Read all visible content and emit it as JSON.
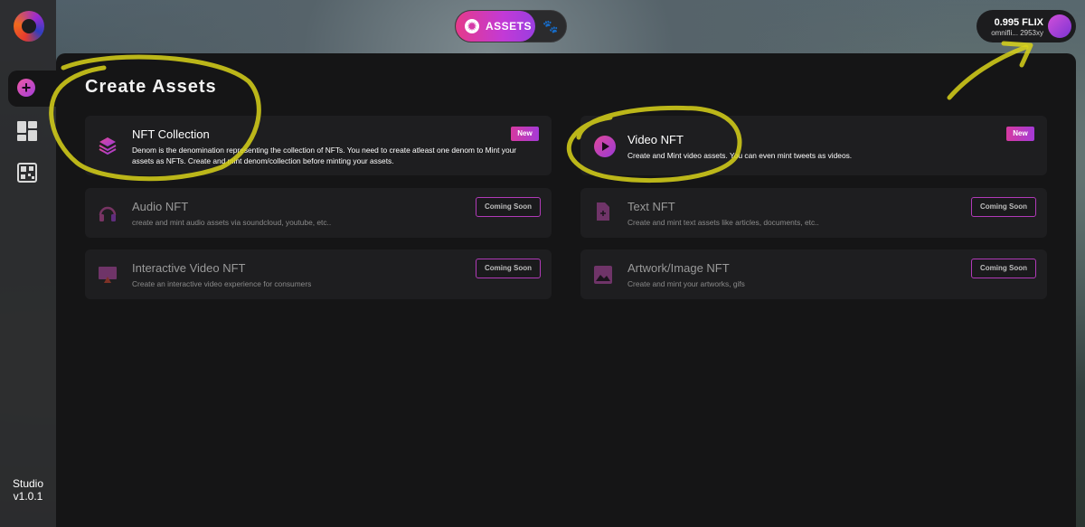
{
  "sidebar": {
    "items": [
      {
        "name": "create",
        "icon": "plus-circle-icon"
      },
      {
        "name": "dashboard",
        "icon": "dashboard-icon"
      },
      {
        "name": "qr",
        "icon": "qr-code-icon"
      }
    ],
    "footer_line1": "Studio",
    "footer_line2": "v1.0.1"
  },
  "header": {
    "tabs": [
      {
        "label": "ASSETS",
        "icon": "gear-icon",
        "active": true
      },
      {
        "label": "",
        "icon": "paw-icon",
        "active": false
      }
    ]
  },
  "wallet": {
    "balance": "0.995 FLIX",
    "address": "omnifli... 2953xy"
  },
  "main": {
    "title": "Create Assets",
    "cards": [
      {
        "title": "NFT Collection",
        "desc": "Denom is the denomination representing the collection of NFTs. You need to create atleast one denom to Mint your assets as NFTs. Create and mint denom/collection before minting your assets.",
        "badge": "New",
        "icon": "layers-icon"
      },
      {
        "title": "Video NFT",
        "desc": "Create and Mint video assets. You can even mint tweets as videos.",
        "badge": "New",
        "icon": "play-icon"
      },
      {
        "title": "Audio NFT",
        "desc": "create and mint audio assets via soundcloud, youtube, etc..",
        "badge": "Coming Soon",
        "icon": "headphones-icon"
      },
      {
        "title": "Text NFT",
        "desc": "Create and mint text assets like articles, documents, etc..",
        "badge": "Coming Soon",
        "icon": "document-icon"
      },
      {
        "title": "Interactive Video NFT",
        "desc": "Create an interactive video experience for consumers",
        "badge": "Coming Soon",
        "icon": "interactive-video-icon"
      },
      {
        "title": "Artwork/Image NFT",
        "desc": "Create and mint your artworks, gifs",
        "badge": "Coming Soon",
        "icon": "image-icon"
      }
    ]
  },
  "colors": {
    "accent_pink": "#e53a8a",
    "accent_purple": "#a53ad6",
    "panel_bg": "#151516",
    "card_bg": "#1e1e20",
    "highlighter": "#d8d21a"
  }
}
